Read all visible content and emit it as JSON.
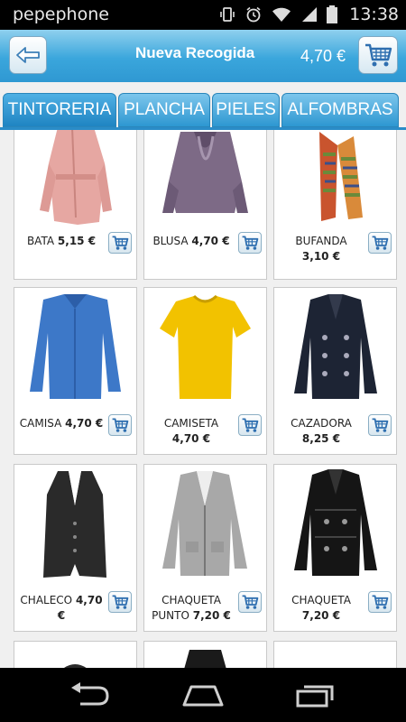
{
  "status_bar": {
    "carrier": "pepephone",
    "time": "13:38"
  },
  "header": {
    "back_icon": "back-arrow-icon",
    "title": "Nueva Recogida",
    "total": "4,70 €",
    "cart_icon": "cart-icon"
  },
  "tabs": [
    {
      "label": "TINTORERIA",
      "active": true
    },
    {
      "label": "PLANCHA"
    },
    {
      "label": "PIELES"
    },
    {
      "label": "ALFOMBRAS"
    }
  ],
  "products": [
    {
      "name": "BATA",
      "price": "5,15 €"
    },
    {
      "name": "BLUSA",
      "price": "4,70 €"
    },
    {
      "name": "BUFANDA",
      "price": "3,10 €"
    },
    {
      "name": "CAMISA",
      "price": "4,70 €"
    },
    {
      "name": "CAMISETA",
      "price": "4,70 €"
    },
    {
      "name": "CAZADORA",
      "price": "8,25 €"
    },
    {
      "name": "CHALECO",
      "price": "4,70 €"
    },
    {
      "name": "CHAQUETA PUNTO",
      "price": "7,20 €"
    },
    {
      "name": "CHAQUETA",
      "price": "7,20 €"
    }
  ],
  "colors": {
    "header": "#3aa6dc",
    "tab": "#2d97d1",
    "card_bg": "#ffffff",
    "page_bg": "#f0f0f0"
  }
}
